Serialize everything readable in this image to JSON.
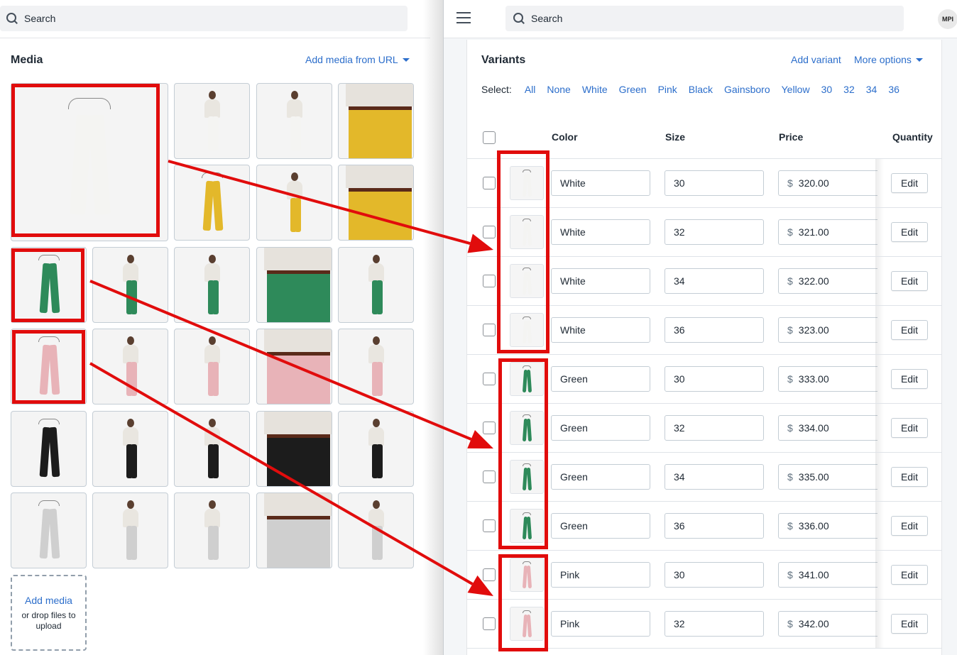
{
  "left": {
    "search_placeholder": "Search",
    "media_title": "Media",
    "add_media_url": "Add media from URL",
    "add_media": "Add media",
    "drop_hint": "or drop files to upload"
  },
  "right": {
    "search_placeholder": "Search",
    "avatar_text": "MPI",
    "variants_title": "Variants",
    "add_variant": "Add variant",
    "more_options": "More options",
    "select_label": "Select:",
    "select_options": [
      "All",
      "None",
      "White",
      "Green",
      "Pink",
      "Black",
      "Gainsboro",
      "Yellow",
      "30",
      "32",
      "34",
      "36"
    ],
    "columns": {
      "color": "Color",
      "size": "Size",
      "price": "Price",
      "quantity": "Quantity"
    },
    "currency": "$",
    "edit_label": "Edit",
    "rows": [
      {
        "color": "White",
        "size": "30",
        "price": "320.00"
      },
      {
        "color": "White",
        "size": "32",
        "price": "321.00"
      },
      {
        "color": "White",
        "size": "34",
        "price": "322.00"
      },
      {
        "color": "White",
        "size": "36",
        "price": "323.00"
      },
      {
        "color": "Green",
        "size": "30",
        "price": "333.00"
      },
      {
        "color": "Green",
        "size": "32",
        "price": "334.00"
      },
      {
        "color": "Green",
        "size": "34",
        "price": "335.00"
      },
      {
        "color": "Green",
        "size": "36",
        "price": "336.00"
      },
      {
        "color": "Pink",
        "size": "30",
        "price": "341.00"
      },
      {
        "color": "Pink",
        "size": "32",
        "price": "342.00"
      }
    ]
  },
  "colors": {
    "accent_link": "#2c6ecb",
    "highlight_red": "#e10c0c",
    "white_pants": "#f4f4f2",
    "yellow_pants": "#e3b82a",
    "green_pants": "#2e8a5a",
    "pink_pants": "#e8b3b8",
    "black_pants": "#1c1c1c",
    "grey_pants": "#cfcfcf"
  }
}
